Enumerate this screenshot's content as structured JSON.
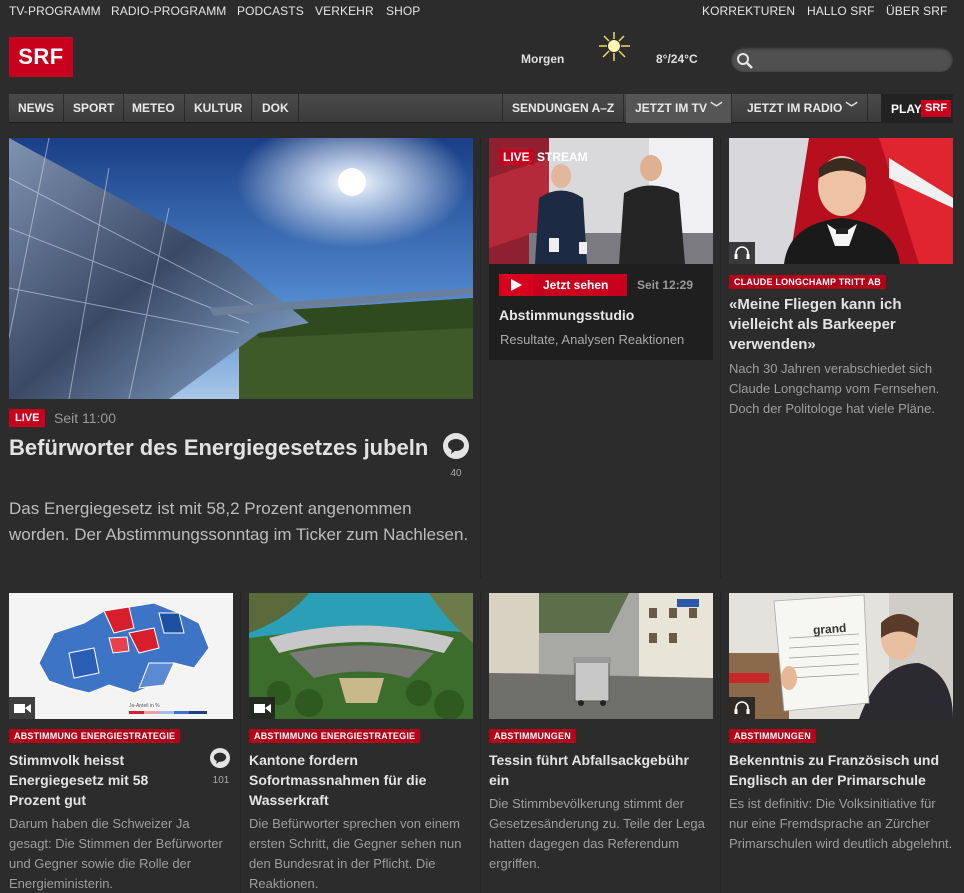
{
  "topbar": {
    "left": [
      "TV-PROGRAMM",
      "RADIO-PROGRAMM",
      "PODCASTS",
      "VERKEHR",
      "SHOP"
    ],
    "right": [
      "KORREKTUREN",
      "HALLO SRF",
      "ÜBER SRF"
    ]
  },
  "header": {
    "logo": "SRF",
    "weather_label": "Morgen",
    "weather_icon": "sun-icon",
    "weather_temp": "8°/24°C",
    "search_placeholder": ""
  },
  "nav": {
    "left": [
      "NEWS",
      "SPORT",
      "METEO",
      "KULTUR",
      "DOK"
    ],
    "right": [
      "SENDUNGEN A–Z",
      "JETZT IM TV ﹀",
      "JETZT IM RADIO ﹀"
    ],
    "play_label": "PLAY",
    "play_badge": "SRF"
  },
  "hero": {
    "live_label": "LIVE",
    "since": "Seit 11:00",
    "title": "Befürworter des Energiegesetzes jubeln",
    "lead": "Das Energiegesetz ist mit 58,2 Prozent angenommen worden. Der Abstimmungssonntag im Ticker zum Nachlesen.",
    "comment_count": "40"
  },
  "livestream": {
    "overlay_live": "LIVE",
    "overlay_stream": "STREAM",
    "watch_label": "Jetzt sehen",
    "since": "Seit 12:29",
    "title": "Abstimmungsstudio",
    "subtitle": "Resultate, Analysen Reaktionen"
  },
  "longchamp": {
    "tag": "CLAUDE LONGCHAMP TRITT AB",
    "title": "«Meine Fliegen kann ich vielleicht als Barkeeper verwenden»",
    "text": "Nach 30 Jahren verabschiedet sich Claude Longchamp vom Fernsehen. Doch der Politologe hat viele Pläne."
  },
  "cards": [
    {
      "tag": "ABSTIMMUNG ENERGIESTRATEGIE",
      "title": "Stimmvolk heisst Energiegesetz mit 58 Prozent gut",
      "text": "Darum haben die Schweizer Ja gesagt: Die Stimmen der Befürworter und Gegner sowie die Rolle der Energieministerin.",
      "comment_count": "101",
      "map_legend": "Ja-Anteil in %"
    },
    {
      "tag": "ABSTIMMUNG ENERGIESTRATEGIE",
      "title": "Kantone fordern Sofortmassnahmen für die Wasserkraft",
      "text": "Die Befürworter sprechen von einem ersten Schritt, die Gegner sehen nun den Bundesrat in der Pflicht. Die Reaktionen."
    },
    {
      "tag": "ABSTIMMUNGEN",
      "title": "Tessin führt Abfallsackgebühr ein",
      "text": "Die Stimmbevölkerung stimmt der Gesetzesänderung zu. Teile der Lega hatten dagegen das Referendum ergriffen."
    },
    {
      "tag": "ABSTIMMUNGEN",
      "title": "Bekenntnis zu Französisch und Englisch an der Primarschule",
      "text": "Es ist definitiv: Die Volksinitiative für nur eine Fremdsprache an Zürcher Primarschulen wird deutlich abgelehnt.",
      "paper_word": "grand"
    }
  ],
  "colors": {
    "brand_red": "#c8001e",
    "background": "#2c2c2c"
  }
}
